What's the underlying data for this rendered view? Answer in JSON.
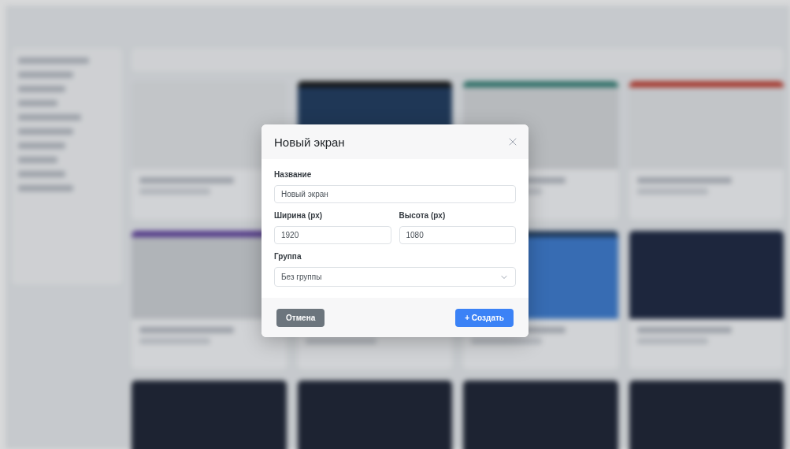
{
  "dialog": {
    "title": "Новый экран",
    "rows": [
      {
        "fields": [
          {
            "kind": "text",
            "label": "Название",
            "value": "Новый экран"
          }
        ]
      },
      {
        "fields": [
          {
            "kind": "text",
            "label": "Ширина (px)",
            "value": "1920"
          },
          {
            "kind": "text",
            "label": "Высота (px)",
            "value": "1080"
          }
        ]
      },
      {
        "fields": [
          {
            "kind": "select",
            "label": "Группа",
            "value": "Без группы"
          }
        ]
      }
    ],
    "buttons": [
      {
        "kind": "secondary",
        "label": "Отмена"
      },
      {
        "kind": "primary",
        "label": "+ Создать"
      }
    ]
  }
}
